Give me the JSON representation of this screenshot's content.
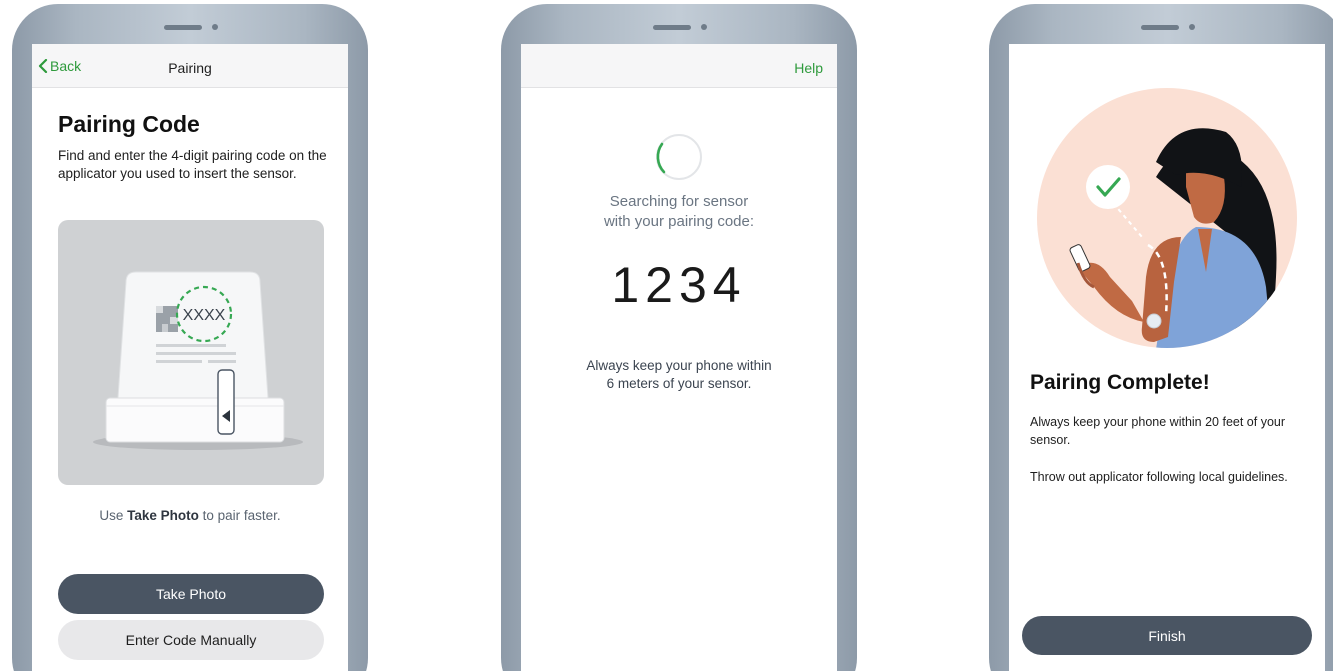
{
  "screen1": {
    "back_label": "Back",
    "nav_title": "Pairing",
    "title": "Pairing Code",
    "description": "Find and enter the 4-digit pairing code on the applicator you used to insert the sensor.",
    "illustration_code": "XXXX",
    "hint_prefix": "Use ",
    "hint_bold": "Take Photo",
    "hint_suffix": " to pair faster.",
    "take_photo_label": "Take Photo",
    "enter_code_label": "Enter Code Manually"
  },
  "screen2": {
    "help_label": "Help",
    "searching_line1": "Searching for sensor",
    "searching_line2": "with your pairing code:",
    "pairing_code": "1234",
    "keep_line1": "Always keep your phone within",
    "keep_line2": "6 meters of your sensor."
  },
  "screen3": {
    "title": "Pairing Complete!",
    "paragraph1": "Always keep your phone within 20 feet of your sensor.",
    "paragraph2": "Throw out applicator following local guidelines.",
    "finish_label": "Finish"
  },
  "colors": {
    "accent_green": "#2e9a3c",
    "button_dark": "#4a5563",
    "button_light": "#e8e8ea",
    "illustration_peach": "#fbe0d4"
  }
}
